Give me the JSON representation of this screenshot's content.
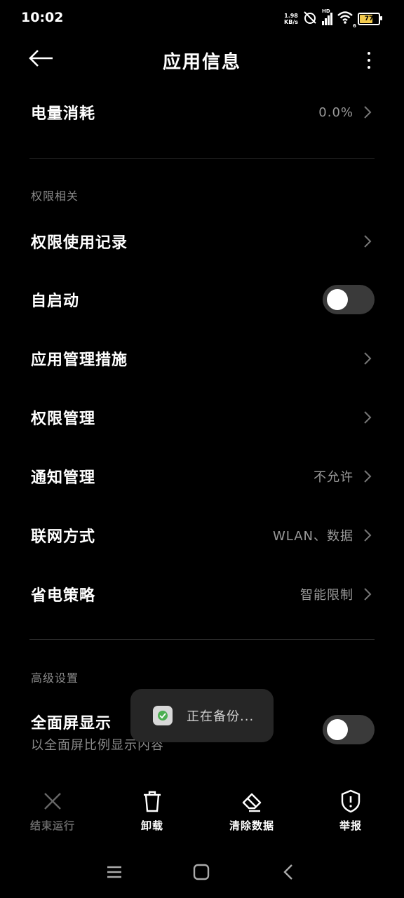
{
  "status_bar": {
    "time": "10:02",
    "speed_value": "1.98",
    "speed_unit": "KB/s",
    "network_label": "HD",
    "wifi_sub": "6",
    "battery_level": "77",
    "battery_fraction": 0.77,
    "battery_color": "#f2c94c"
  },
  "header": {
    "title": "应用信息",
    "back_icon": "arrow-left-icon",
    "more_icon": "more-vertical-icon"
  },
  "battery_row": {
    "label": "电量消耗",
    "value": "0.0%"
  },
  "permissions_section": {
    "title": "权限相关",
    "items": [
      {
        "label": "权限使用记录",
        "value": ""
      },
      {
        "label": "自启动",
        "toggle": false
      },
      {
        "label": "应用管理措施",
        "value": ""
      },
      {
        "label": "权限管理",
        "value": ""
      },
      {
        "label": "通知管理",
        "value": "不允许"
      },
      {
        "label": "联网方式",
        "value": "WLAN、数据"
      },
      {
        "label": "省电策略",
        "value": "智能限制"
      }
    ]
  },
  "advanced_section": {
    "title": "高级设置",
    "fullscreen": {
      "label": "全面屏显示",
      "sublabel": "以全面屏比例显示内容",
      "toggle": false
    }
  },
  "toast": {
    "text": "正在备份...",
    "icon": "app-backup-icon"
  },
  "actions": [
    {
      "label": "结束运行",
      "icon": "close-icon",
      "enabled": false
    },
    {
      "label": "卸载",
      "icon": "trash-icon",
      "enabled": true
    },
    {
      "label": "清除数据",
      "icon": "eraser-icon",
      "enabled": true
    },
    {
      "label": "举报",
      "icon": "shield-alert-icon",
      "enabled": true
    }
  ],
  "nav_bar": {
    "icons": [
      "menu-icon",
      "home-icon",
      "back-icon"
    ]
  }
}
